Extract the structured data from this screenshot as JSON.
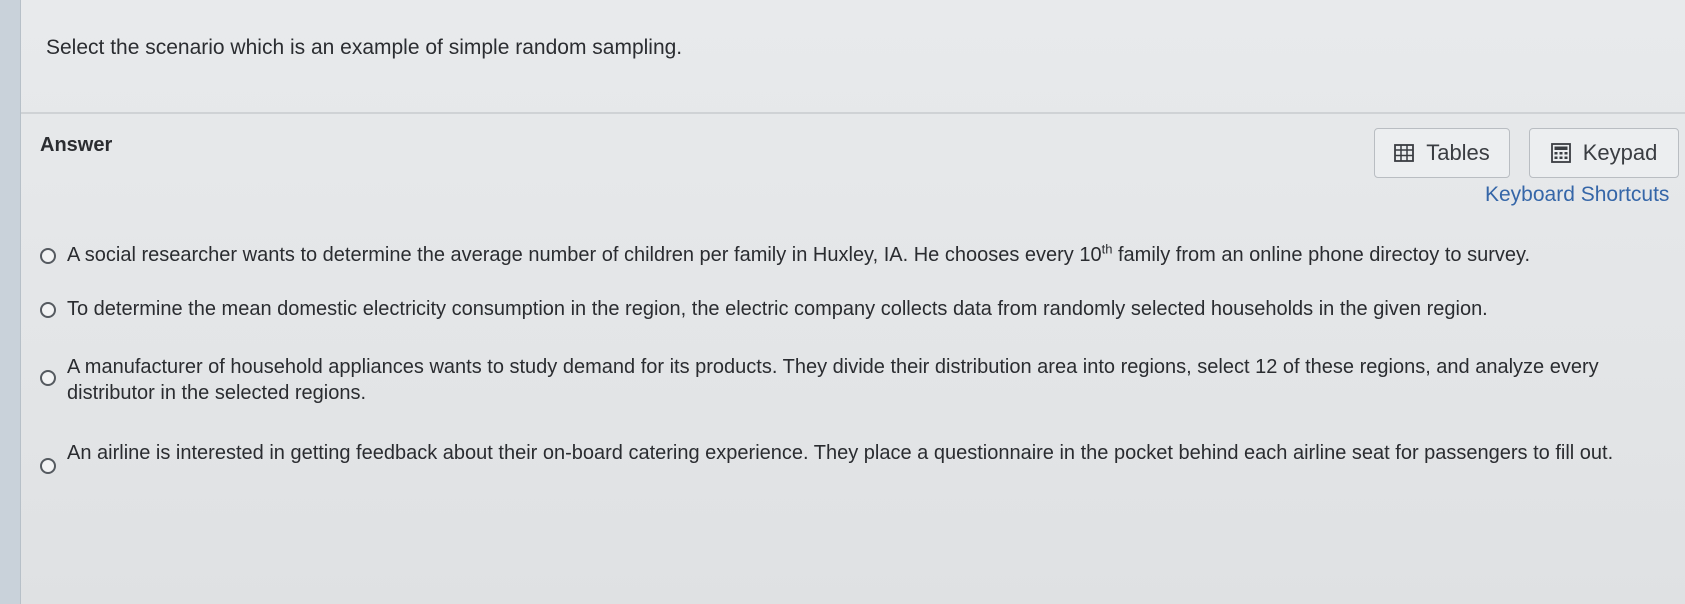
{
  "question": {
    "text": "Select the scenario which is an example of simple random sampling."
  },
  "answer": {
    "label": "Answer"
  },
  "toolbar": {
    "tables_label": "Tables",
    "keypad_label": "Keypad",
    "shortcuts_label": "Keyboard Shortcuts",
    "tables_icon": "table-grid-icon",
    "keypad_icon": "calculator-keypad-icon"
  },
  "options": [
    {
      "text_before": "A social researcher wants to determine the average number of children per family in Huxley, IA. He chooses every 10",
      "superscript": "th",
      "text_after": " family from an online phone directoy to survey.",
      "selected": false
    },
    {
      "text": "To determine the mean domestic electricity consumption in the region, the electric company collects data from randomly selected households in the given region.",
      "selected": false
    },
    {
      "text": "A manufacturer of household appliances wants to study demand for its products. They divide their distribution area into regions, select 12 of these regions, and analyze every distributor in the selected regions.",
      "selected": false
    },
    {
      "text": "An airline is interested in getting feedback about their on-board catering experience. They place a questionnaire in the pocket behind each airline seat for passengers to fill out.",
      "selected": false
    }
  ],
  "colors": {
    "link": "#3566a8",
    "background": "#e4e6e8",
    "text": "#2a2c30"
  }
}
